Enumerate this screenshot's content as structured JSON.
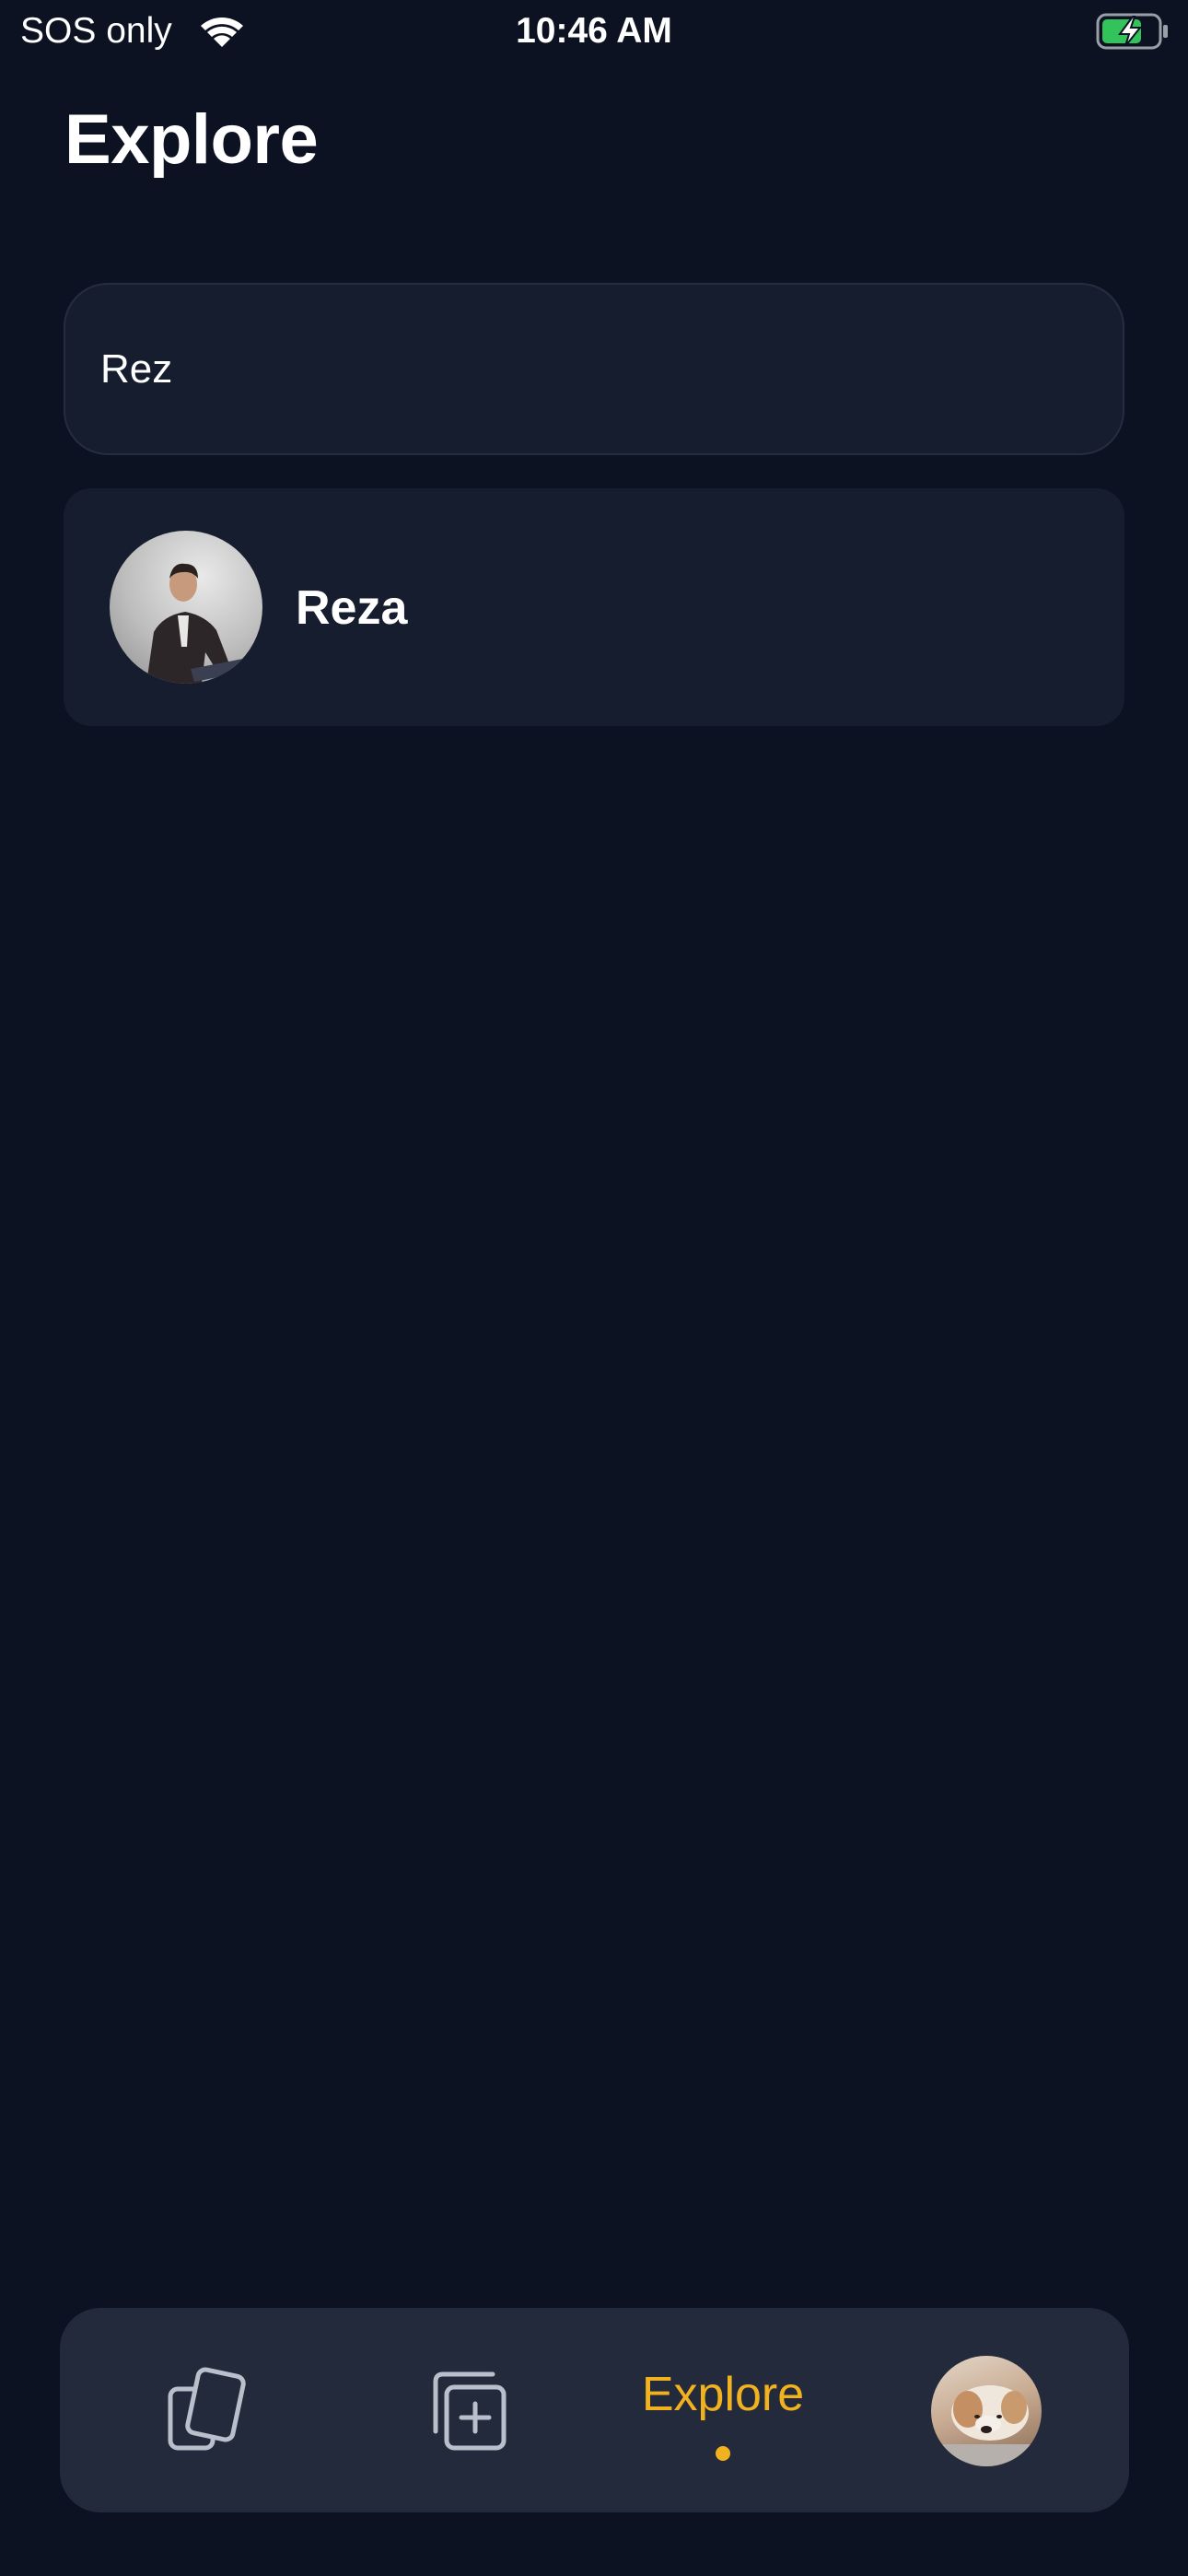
{
  "status_bar": {
    "carrier": "SOS only",
    "time": "10:46 AM",
    "battery_state": "charging",
    "battery_color": "#32c35a"
  },
  "page": {
    "title": "Explore"
  },
  "search": {
    "value": "Rez",
    "placeholder": ""
  },
  "results": [
    {
      "name": "Reza"
    }
  ],
  "tab_bar": {
    "tabs": [
      {
        "id": "cards",
        "icon": "cards-icon",
        "active": false
      },
      {
        "id": "create",
        "icon": "add-square-icon",
        "active": false
      },
      {
        "id": "explore",
        "label": "Explore",
        "active": true
      },
      {
        "id": "profile",
        "icon": "profile-avatar",
        "active": false
      }
    ],
    "active_color": "#f2b11e",
    "inactive_color": "#b9c0cc"
  },
  "colors": {
    "background": "#0c1221",
    "card": "#161d2e",
    "tab_bar": "#222a3b",
    "accent": "#f2b11e"
  }
}
